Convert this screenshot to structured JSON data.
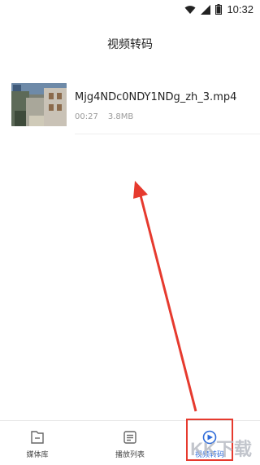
{
  "status_bar": {
    "time": "10:32"
  },
  "header": {
    "title": "视频转码"
  },
  "video": {
    "filename": "Mjg4NDc0NDY1NDg_zh_3.mp4",
    "duration": "00:27",
    "size": "3.8MB"
  },
  "tabs": [
    {
      "label": "媒体库",
      "icon": "folder-icon",
      "active": false
    },
    {
      "label": "播放列表",
      "icon": "playlist-icon",
      "active": false
    },
    {
      "label": "视频转码",
      "icon": "convert-icon",
      "active": true
    }
  ],
  "watermark": {
    "text": "KK下载"
  },
  "colors": {
    "accent": "#2e6bd9",
    "annotation_red": "#e63a2e"
  }
}
